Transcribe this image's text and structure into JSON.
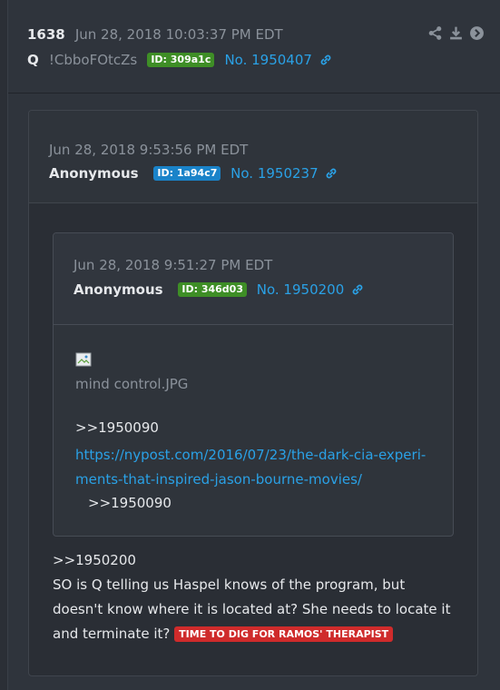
{
  "post": {
    "number": "1638",
    "timestamp": "Jun 28, 2018 10:03:37 PM EDT",
    "name": "Q",
    "tripcode": "!CbboFOtcZs",
    "id": "ID: 309a1c",
    "post_no": "No. 1950407"
  },
  "toolbar": {
    "icons": [
      "share-icon",
      "download-icon",
      "navigate-icon"
    ]
  },
  "quote1": {
    "timestamp": "Jun 28, 2018 9:53:56 PM EDT",
    "name": "Anonymous",
    "id": "ID: 1a94c7",
    "post_no": "No. 1950237"
  },
  "quote2": {
    "timestamp": "Jun 28, 2018 9:51:27 PM EDT",
    "name": "Anonymous",
    "id": "ID: 346d03",
    "post_no": "No. 1950200",
    "filename": "mind control.JPG",
    "ref1": ">>1950090",
    "url_line1": "https://nypost.com/2016/07/23/the-dark-cia-experi-",
    "url_line2": "ments-that-inspired-jason-bourne-movies/",
    "ref2": ">>1950090"
  },
  "reply": {
    "ref": ">>1950200",
    "text": "SO is Q telling us Haspel knows of the program, but doesn't know where it is located at? She needs to locate it and terminate it?",
    "tag": "TIME TO DIG FOR RAMOS' THERAPIST"
  },
  "colors": {
    "link": "#2aa1e6",
    "id_green": "#3e8e26",
    "id_blue": "#1a83c9",
    "tag_red": "#cf2b2b"
  }
}
